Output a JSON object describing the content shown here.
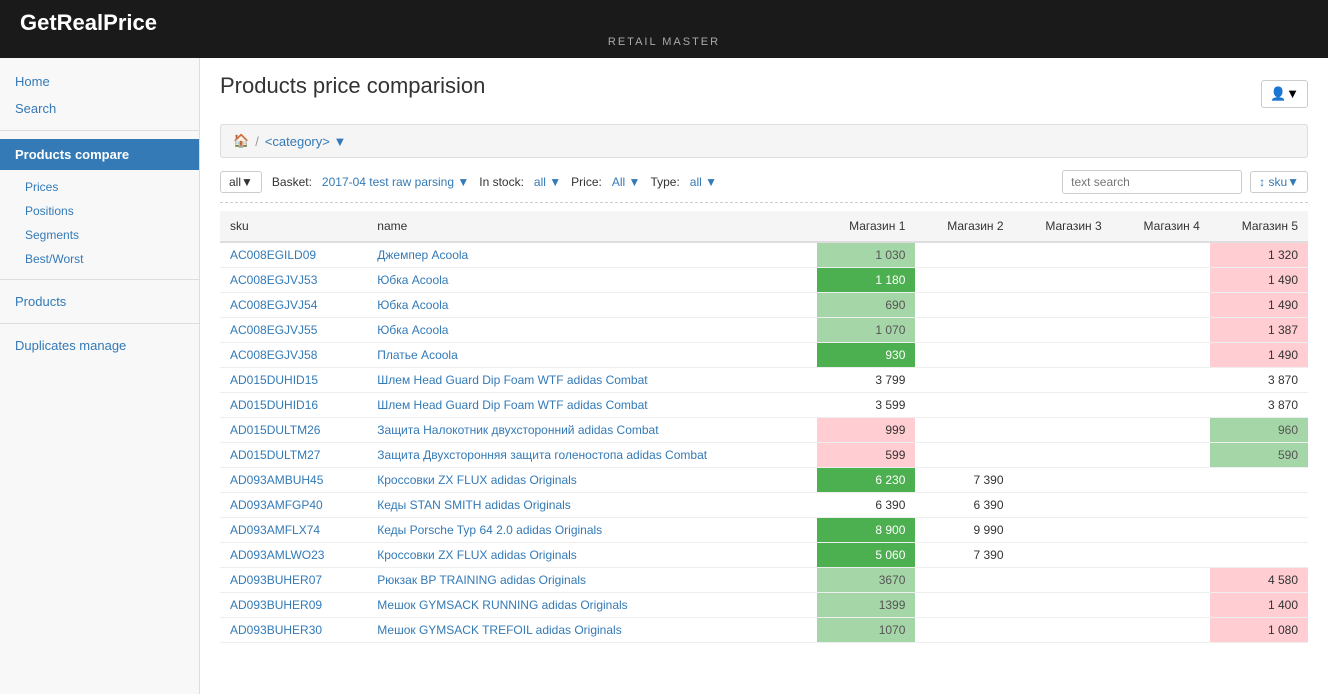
{
  "header": {
    "brand": "GetRealPrice",
    "sub": "RETAIL MASTER"
  },
  "sidebar": {
    "home_label": "Home",
    "search_label": "Search",
    "products_compare_label": "Products compare",
    "sub_items": [
      "Prices",
      "Positions",
      "Segments",
      "Best/Worst"
    ],
    "products_label": "Products",
    "duplicates_label": "Duplicates manage"
  },
  "main": {
    "page_title": "Products price comparision",
    "breadcrumb": {
      "home_icon": "🏠",
      "separator": "/",
      "category": "<category>"
    },
    "toolbar": {
      "all_label": "all▼",
      "basket_label": "Basket:",
      "basket_value": "2017-04 test raw parsing",
      "basket_dropdown": "▼",
      "in_stock_label": "In stock:",
      "in_stock_value": "all",
      "in_stock_dropdown": "▼",
      "price_label": "Price:",
      "price_value": "All",
      "price_dropdown": "▼",
      "type_label": "Type:",
      "type_value": "all",
      "type_dropdown": "▼",
      "search_placeholder": "text search",
      "sort_label": "↕ sku▼"
    },
    "table": {
      "columns": [
        "sku",
        "name",
        "Магазин 1",
        "Магазин 2",
        "Магазин 3",
        "Магазин 4",
        "Магазин 5"
      ],
      "rows": [
        {
          "sku": "AC008EGILD09",
          "name": "Джемпер Acoola",
          "m1": "1 030",
          "m1_class": "price-green-light",
          "m2": "",
          "m2_class": "",
          "m3": "",
          "m3_class": "",
          "m4": "",
          "m4_class": "",
          "m5": "1 320",
          "m5_class": "price-red-light"
        },
        {
          "sku": "AC008EGJVJ53",
          "name": "Юбка Acoola",
          "m1": "1 180",
          "m1_class": "price-green-dark",
          "m2": "",
          "m2_class": "",
          "m3": "",
          "m3_class": "",
          "m4": "",
          "m4_class": "",
          "m5": "1 490",
          "m5_class": "price-red-light"
        },
        {
          "sku": "AC008EGJVJ54",
          "name": "Юбка Acoola",
          "m1": "690",
          "m1_class": "price-green-light",
          "m2": "",
          "m2_class": "",
          "m3": "",
          "m3_class": "",
          "m4": "",
          "m4_class": "",
          "m5": "1 490",
          "m5_class": "price-red-light"
        },
        {
          "sku": "AC008EGJVJ55",
          "name": "Юбка Acoola",
          "m1": "1 070",
          "m1_class": "price-green-light",
          "m2": "",
          "m2_class": "",
          "m3": "",
          "m3_class": "",
          "m4": "",
          "m4_class": "",
          "m5": "1 387",
          "m5_class": "price-red-light"
        },
        {
          "sku": "AC008EGJVJ58",
          "name": "Платье Acoola",
          "m1": "930",
          "m1_class": "price-green-dark",
          "m2": "",
          "m2_class": "",
          "m3": "",
          "m3_class": "",
          "m4": "",
          "m4_class": "",
          "m5": "1 490",
          "m5_class": "price-red-light"
        },
        {
          "sku": "AD015DUHID15",
          "name": "Шлем Head Guard Dip Foam WTF adidas Combat",
          "m1": "3 799",
          "m1_class": "price-plain",
          "m2": "",
          "m2_class": "",
          "m3": "",
          "m3_class": "",
          "m4": "",
          "m4_class": "",
          "m5": "3 870",
          "m5_class": "price-plain"
        },
        {
          "sku": "AD015DUHID16",
          "name": "Шлем Head Guard Dip Foam WTF adidas Combat",
          "m1": "3 599",
          "m1_class": "price-plain",
          "m2": "",
          "m2_class": "",
          "m3": "",
          "m3_class": "",
          "m4": "",
          "m4_class": "",
          "m5": "3 870",
          "m5_class": "price-plain"
        },
        {
          "sku": "AD015DULTM26",
          "name": "Защита Налокотник двухсторонний adidas Combat",
          "m1": "999",
          "m1_class": "price-red-light",
          "m2": "",
          "m2_class": "",
          "m3": "",
          "m3_class": "",
          "m4": "",
          "m4_class": "",
          "m5": "960",
          "m5_class": "price-green-light"
        },
        {
          "sku": "AD015DULTM27",
          "name": "Защита Двухсторонняя защита голеностопа adidas Combat",
          "m1": "599",
          "m1_class": "price-red-light",
          "m2": "",
          "m2_class": "",
          "m3": "",
          "m3_class": "",
          "m4": "",
          "m4_class": "",
          "m5": "590",
          "m5_class": "price-green-light"
        },
        {
          "sku": "AD093AMBUH45",
          "name": "Кроссовки ZX FLUX adidas Originals",
          "m1": "6 230",
          "m1_class": "price-green-dark",
          "m2": "7 390",
          "m2_class": "price-plain",
          "m3": "",
          "m3_class": "",
          "m4": "",
          "m4_class": "",
          "m5": "",
          "m5_class": ""
        },
        {
          "sku": "AD093AMFGP40",
          "name": "Кеды STAN SMITH adidas Originals",
          "m1": "6 390",
          "m1_class": "price-plain",
          "m2": "6 390",
          "m2_class": "price-plain",
          "m3": "",
          "m3_class": "",
          "m4": "",
          "m4_class": "",
          "m5": "",
          "m5_class": ""
        },
        {
          "sku": "AD093AMFLX74",
          "name": "Кеды Porsche Typ 64 2.0 adidas Originals",
          "m1": "8 900",
          "m1_class": "price-green-dark",
          "m2": "9 990",
          "m2_class": "price-plain",
          "m3": "",
          "m3_class": "",
          "m4": "",
          "m4_class": "",
          "m5": "",
          "m5_class": ""
        },
        {
          "sku": "AD093AMLWO23",
          "name": "Кроссовки ZX FLUX adidas Originals",
          "m1": "5 060",
          "m1_class": "price-green-dark",
          "m2": "7 390",
          "m2_class": "price-plain",
          "m3": "",
          "m3_class": "",
          "m4": "",
          "m4_class": "",
          "m5": "",
          "m5_class": ""
        },
        {
          "sku": "AD093BUHER07",
          "name": "Рюкзак BP TRAINING adidas Originals",
          "m1": "3670",
          "m1_class": "price-green-light",
          "m2": "",
          "m2_class": "",
          "m3": "",
          "m3_class": "",
          "m4": "",
          "m4_class": "",
          "m5": "4 580",
          "m5_class": "price-red-light"
        },
        {
          "sku": "AD093BUHER09",
          "name": "Мешок GYMSACK RUNNING adidas Originals",
          "m1": "1399",
          "m1_class": "price-green-light",
          "m2": "",
          "m2_class": "",
          "m3": "",
          "m3_class": "",
          "m4": "",
          "m4_class": "",
          "m5": "1 400",
          "m5_class": "price-red-light"
        },
        {
          "sku": "AD093BUHER30",
          "name": "Мешок GYMSACK TREFOIL adidas Originals",
          "m1": "1070",
          "m1_class": "price-green-light",
          "m2": "",
          "m2_class": "",
          "m3": "",
          "m3_class": "",
          "m4": "",
          "m4_class": "",
          "m5": "1 080",
          "m5_class": "price-red-light"
        }
      ]
    }
  }
}
